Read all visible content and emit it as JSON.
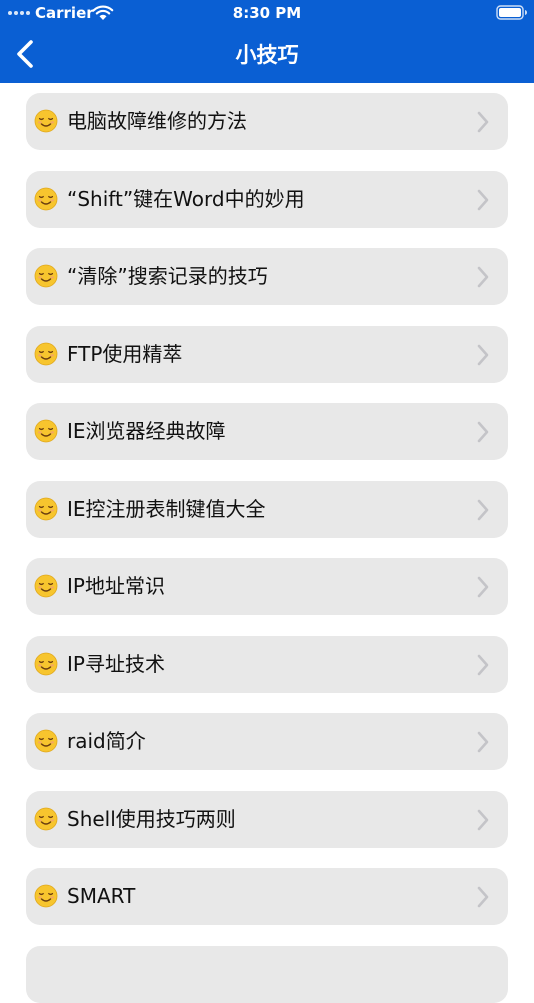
{
  "status_bar": {
    "carrier": "Carrier",
    "time": "8:30 PM",
    "wifi_icon": "wifi-icon",
    "battery_icon": "battery-icon"
  },
  "nav": {
    "title": "小技巧",
    "back_icon": "chevron-left-icon"
  },
  "colors": {
    "header": "#0a5fd3",
    "item_background": "#e8e8e8",
    "chevron": "#c4c4c8",
    "emoji_face": "#f7c52e"
  },
  "list": {
    "item_icon": "smiling-face-icon",
    "chevron_icon": "chevron-right-icon",
    "items": [
      {
        "label": "电脑故障维修的方法"
      },
      {
        "label": "“Shift”键在Word中的妙用"
      },
      {
        "label": "“清除”搜索记录的技巧"
      },
      {
        "label": "FTP使用精萃"
      },
      {
        "label": "IE浏览器经典故障"
      },
      {
        "label": "IE控注册表制键值大全"
      },
      {
        "label": "IP地址常识"
      },
      {
        "label": "IP寻址技术"
      },
      {
        "label": "raid简介"
      },
      {
        "label": "Shell使用技巧两则"
      },
      {
        "label": "SMART"
      },
      {
        "label": ""
      }
    ]
  }
}
